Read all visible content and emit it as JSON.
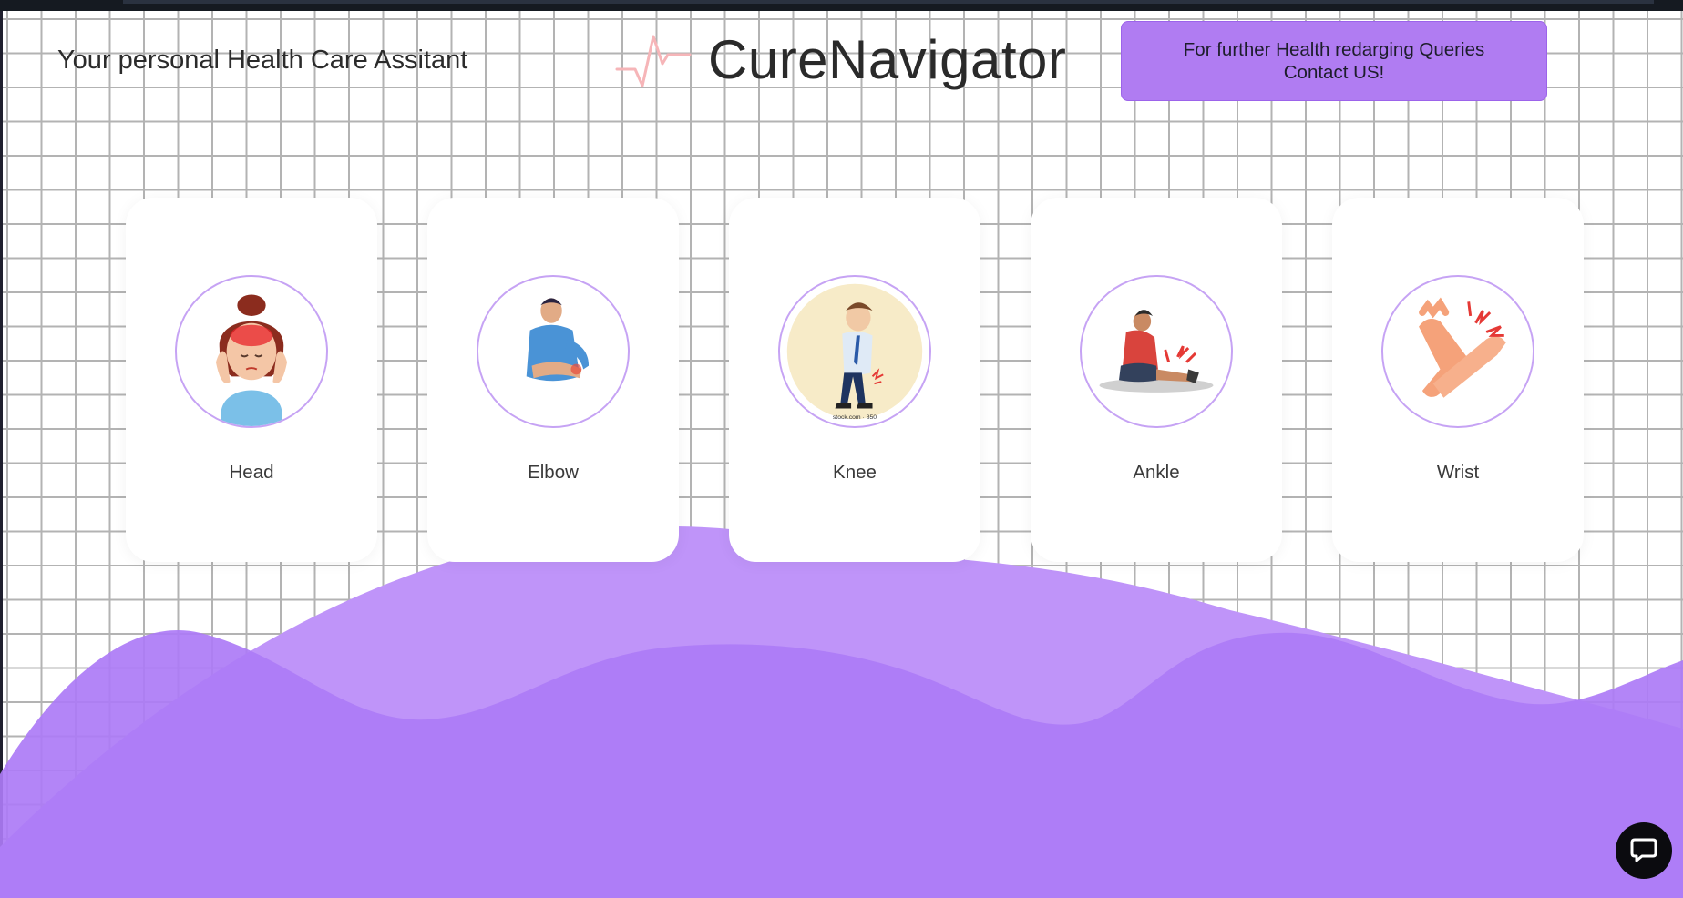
{
  "header": {
    "tagline": "Your personal Health Care Assitant",
    "brand_name": "CureNavigator",
    "contact_label": "For further Health redarging Queries Contact US!"
  },
  "body_parts": [
    {
      "label": "Head",
      "icon": "head-pain-icon"
    },
    {
      "label": "Elbow",
      "icon": "elbow-pain-icon"
    },
    {
      "label": "Knee",
      "icon": "knee-pain-icon"
    },
    {
      "label": "Ankle",
      "icon": "ankle-pain-icon"
    },
    {
      "label": "Wrist",
      "icon": "wrist-pain-icon"
    }
  ],
  "knee_caption": "stock.com · 850",
  "colors": {
    "accent": "#b07cf2",
    "wave_light": "#bf94f9",
    "wave_dark": "#ad7bf6",
    "topbar": "#151a21",
    "chat_button": "#0b0b0f"
  },
  "chat": {
    "icon": "chat-bubble-icon"
  }
}
